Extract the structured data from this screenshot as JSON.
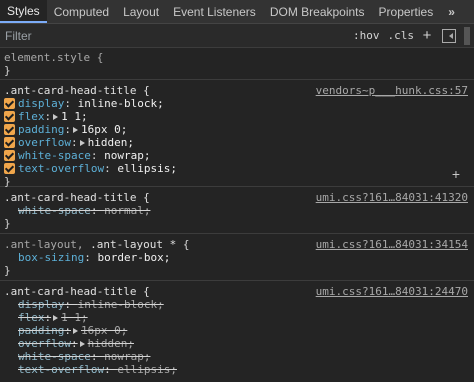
{
  "tabs": [
    {
      "label": "Styles"
    },
    {
      "label": "Computed"
    },
    {
      "label": "Layout"
    },
    {
      "label": "Event Listeners"
    },
    {
      "label": "DOM Breakpoints"
    },
    {
      "label": "Properties"
    }
  ],
  "tab_more": "»",
  "filter": {
    "placeholder": "Filter",
    "hov": ":hov",
    "cls": ".cls",
    "add": "+"
  },
  "rules": [
    {
      "selector": "element.style {",
      "close": "}"
    },
    {
      "selector": ".ant-card-head-title {",
      "source": "vendors~p___hunk.css:57",
      "props": [
        {
          "name": "display",
          "value": "inline-block;"
        },
        {
          "name": "flex",
          "value": "1 1;"
        },
        {
          "name": "padding",
          "value": "16px 0;"
        },
        {
          "name": "overflow",
          "value": "hidden;"
        },
        {
          "name": "white-space",
          "value": "nowrap;"
        },
        {
          "name": "text-overflow",
          "value": "ellipsis;"
        }
      ],
      "close": "}",
      "add": "+"
    },
    {
      "selector": ".ant-card-head-title {",
      "source": "umi.css?161…84031:41320",
      "props": [
        {
          "name": "white-space",
          "value": "normal;"
        }
      ],
      "close": "}"
    },
    {
      "selector_a": ".ant-layout,",
      "selector_b": ".ant-layout *",
      "brace": "{",
      "source": "umi.css?161…84031:34154",
      "props": [
        {
          "name": "box-sizing",
          "value": "border-box;"
        }
      ],
      "close": "}"
    },
    {
      "selector": ".ant-card-head-title {",
      "source": "umi.css?161…84031:24470",
      "props": [
        {
          "name": "display",
          "value": "inline-block;"
        },
        {
          "name": "flex",
          "value": "1 1;"
        },
        {
          "name": "padding",
          "value": "16px 0;"
        },
        {
          "name": "overflow",
          "value": "hidden;"
        },
        {
          "name": "white-space",
          "value": "nowrap;"
        },
        {
          "name": "text-overflow",
          "value": "ellipsis;"
        }
      ]
    }
  ]
}
